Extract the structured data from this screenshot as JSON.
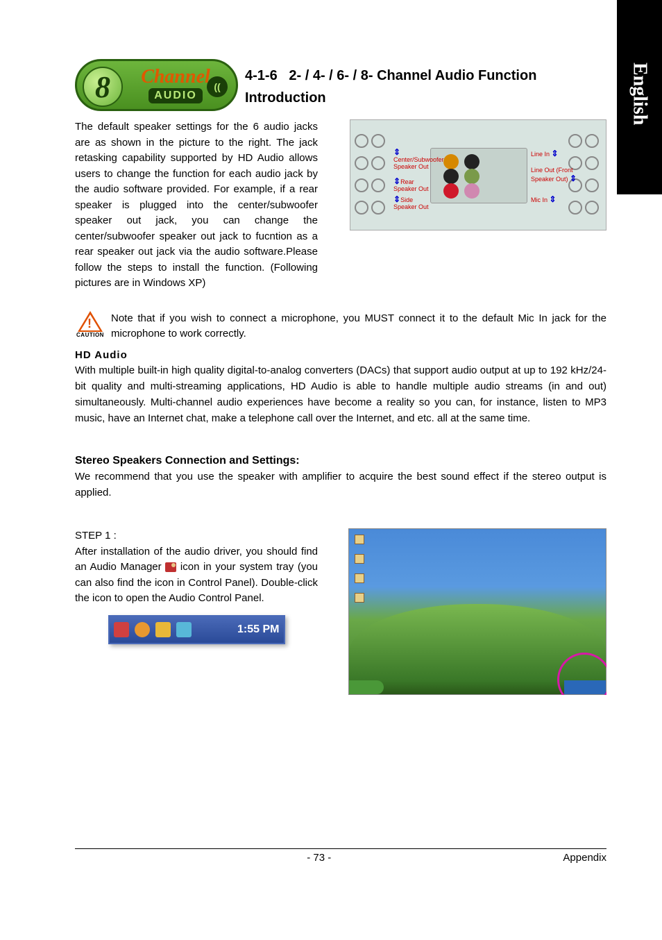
{
  "side_tab": "English",
  "logo": {
    "digit": "8",
    "line1": "Channel",
    "line2": "AUDIO",
    "speaker": "(("
  },
  "section": {
    "number": "4-1-6",
    "title": "2- / 4- / 6- / 8- Channel Audio Function Introduction"
  },
  "intro_para": "The default speaker settings for the 6 audio jacks are as shown in the picture to the right. The jack retasking capability supported by HD Audio allows users to change the function for each audio jack by the audio software provided. For example, if a rear speaker is plugged into the center/subwoofer speaker out jack, you can change the center/subwoofer speaker out jack to fucntion as a rear speaker out jack via the audio software.Please follow the steps to install the function. (Following pictures are in Windows XP)",
  "diagram_labels": {
    "l1": "Center/Subwoofer Speaker Out",
    "l2": "Rear Speaker Out",
    "l3": "Side Speaker Out",
    "r1": "Line In",
    "r2": "Line Out (Front Speaker Out)",
    "r3": "Mic In"
  },
  "caution": {
    "label": "CAUTION",
    "text": "Note that if you wish to connect a microphone, you MUST connect it to the default Mic In jack for the microphone to work correctly."
  },
  "hd_audio": {
    "heading": "HD Audio",
    "text": "With multiple built-in high quality digital-to-analog converters (DACs) that support audio output at up to 192 kHz/24-bit quality and multi-streaming applications, HD Audio is able to handle multiple audio streams (in and out) simultaneously. Multi-channel audio experiences have become a reality so you can, for instance,  listen to MP3 music, have an Internet chat, make a telephone call over the Internet, and etc. all at the same time."
  },
  "stereo": {
    "heading": "Stereo Speakers Connection and Settings:",
    "text": "We recommend that you use the speaker with amplifier to acquire the best sound effect if the stereo output is applied."
  },
  "step1": {
    "label": "STEP 1 :",
    "text_a": "After installation of the audio driver, you should find an Audio Manager",
    "text_b": "icon in your system tray (you can also find the icon in Control Panel).  Double-click the icon to open the Audio Control Panel."
  },
  "systray": {
    "time": "1:55 PM"
  },
  "footer": {
    "page": "- 73 -",
    "section": "Appendix"
  }
}
